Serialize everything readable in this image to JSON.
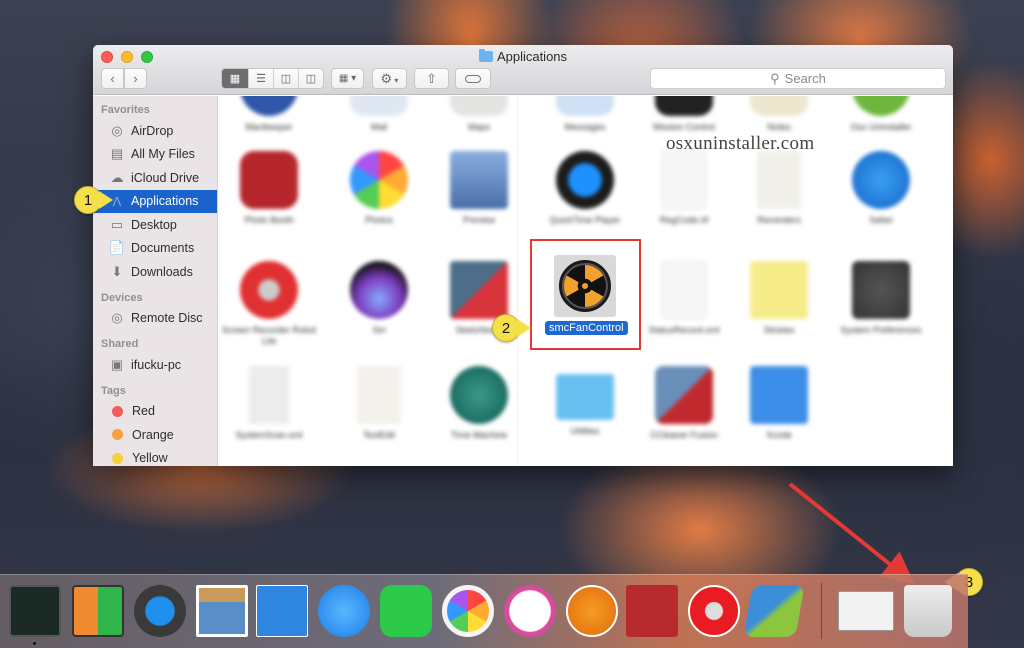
{
  "window": {
    "title": "Applications",
    "search_placeholder": "Search",
    "toolbar": {
      "back_icon": "chevron-left-icon",
      "forward_icon": "chevron-right-icon",
      "view_modes": [
        "icon-view",
        "list-view",
        "column-view",
        "cover-flow-view"
      ],
      "active_view": "icon-view",
      "arrange_icon": "arrange-grid-icon",
      "action_icon": "gear-icon",
      "share_icon": "share-icon",
      "tag_icon": "tag-icon"
    }
  },
  "sidebar": {
    "sections": [
      {
        "title": "Favorites",
        "items": [
          {
            "label": "AirDrop",
            "icon": "airdrop-icon"
          },
          {
            "label": "All My Files",
            "icon": "all-files-icon"
          },
          {
            "label": "iCloud Drive",
            "icon": "cloud-icon"
          },
          {
            "label": "Applications",
            "icon": "applications-icon",
            "selected": true
          },
          {
            "label": "Desktop",
            "icon": "desktop-icon"
          },
          {
            "label": "Documents",
            "icon": "documents-icon"
          },
          {
            "label": "Downloads",
            "icon": "downloads-icon"
          }
        ]
      },
      {
        "title": "Devices",
        "items": [
          {
            "label": "Remote Disc",
            "icon": "disc-icon"
          }
        ]
      },
      {
        "title": "Shared",
        "items": [
          {
            "label": "ifucku-pc",
            "icon": "monitor-icon"
          }
        ]
      },
      {
        "title": "Tags",
        "items": [
          {
            "label": "Red",
            "color": "#f45a59"
          },
          {
            "label": "Orange",
            "color": "#f6a13e"
          },
          {
            "label": "Yellow",
            "color": "#f4d03f"
          }
        ]
      }
    ]
  },
  "content": {
    "apps": [
      {
        "label": "Manikeeper"
      },
      {
        "label": "Mail"
      },
      {
        "label": "Maps"
      },
      {
        "label": "Messages"
      },
      {
        "label": "Mission Control"
      },
      {
        "label": "Notes"
      },
      {
        "label": "Osx Uninstaller"
      },
      {
        "label": "Photo Booth"
      },
      {
        "label": "Photos"
      },
      {
        "label": "Preview"
      },
      {
        "label": "QuickTime Player"
      },
      {
        "label": "RegCode.rtf"
      },
      {
        "label": "Reminders"
      },
      {
        "label": "Safari"
      },
      {
        "label": "Screen Recorder Robot Lite"
      },
      {
        "label": "Siri"
      },
      {
        "label": "Sketchbook"
      },
      {
        "label": "smcFanControl",
        "selected": true
      },
      {
        "label": "StatusRecord.xml"
      },
      {
        "label": "Stickies"
      },
      {
        "label": "System Preferences"
      },
      {
        "label": "SystemScan.xml"
      },
      {
        "label": "TextEdit"
      },
      {
        "label": "Time Machine"
      },
      {
        "label": "Utilities"
      },
      {
        "label": "CCleaner Fusion"
      },
      {
        "label": "Xcode"
      }
    ],
    "selected_app": "smcFanControl",
    "watermark": "osxuninstaller.com"
  },
  "callouts": [
    "1",
    "2",
    "3"
  ],
  "dock": {
    "items": [
      {
        "name": "Activity Monitor",
        "running": true
      },
      {
        "name": "Mission Control"
      },
      {
        "name": "QuickTime Player"
      },
      {
        "name": "Preview"
      },
      {
        "name": "Xcode"
      },
      {
        "name": "Messages"
      },
      {
        "name": "FaceTime"
      },
      {
        "name": "Photos"
      },
      {
        "name": "iTunes"
      },
      {
        "name": "iBooks"
      },
      {
        "name": "Photo Booth"
      },
      {
        "name": "Screen Recorder"
      },
      {
        "name": "Osx Uninstaller"
      },
      {
        "name": "Safari Window"
      },
      {
        "name": "Trash"
      }
    ]
  },
  "colors": {
    "selection": "#1a63cc",
    "callout": "#f6e04a",
    "highlight_box": "#e53a34"
  }
}
